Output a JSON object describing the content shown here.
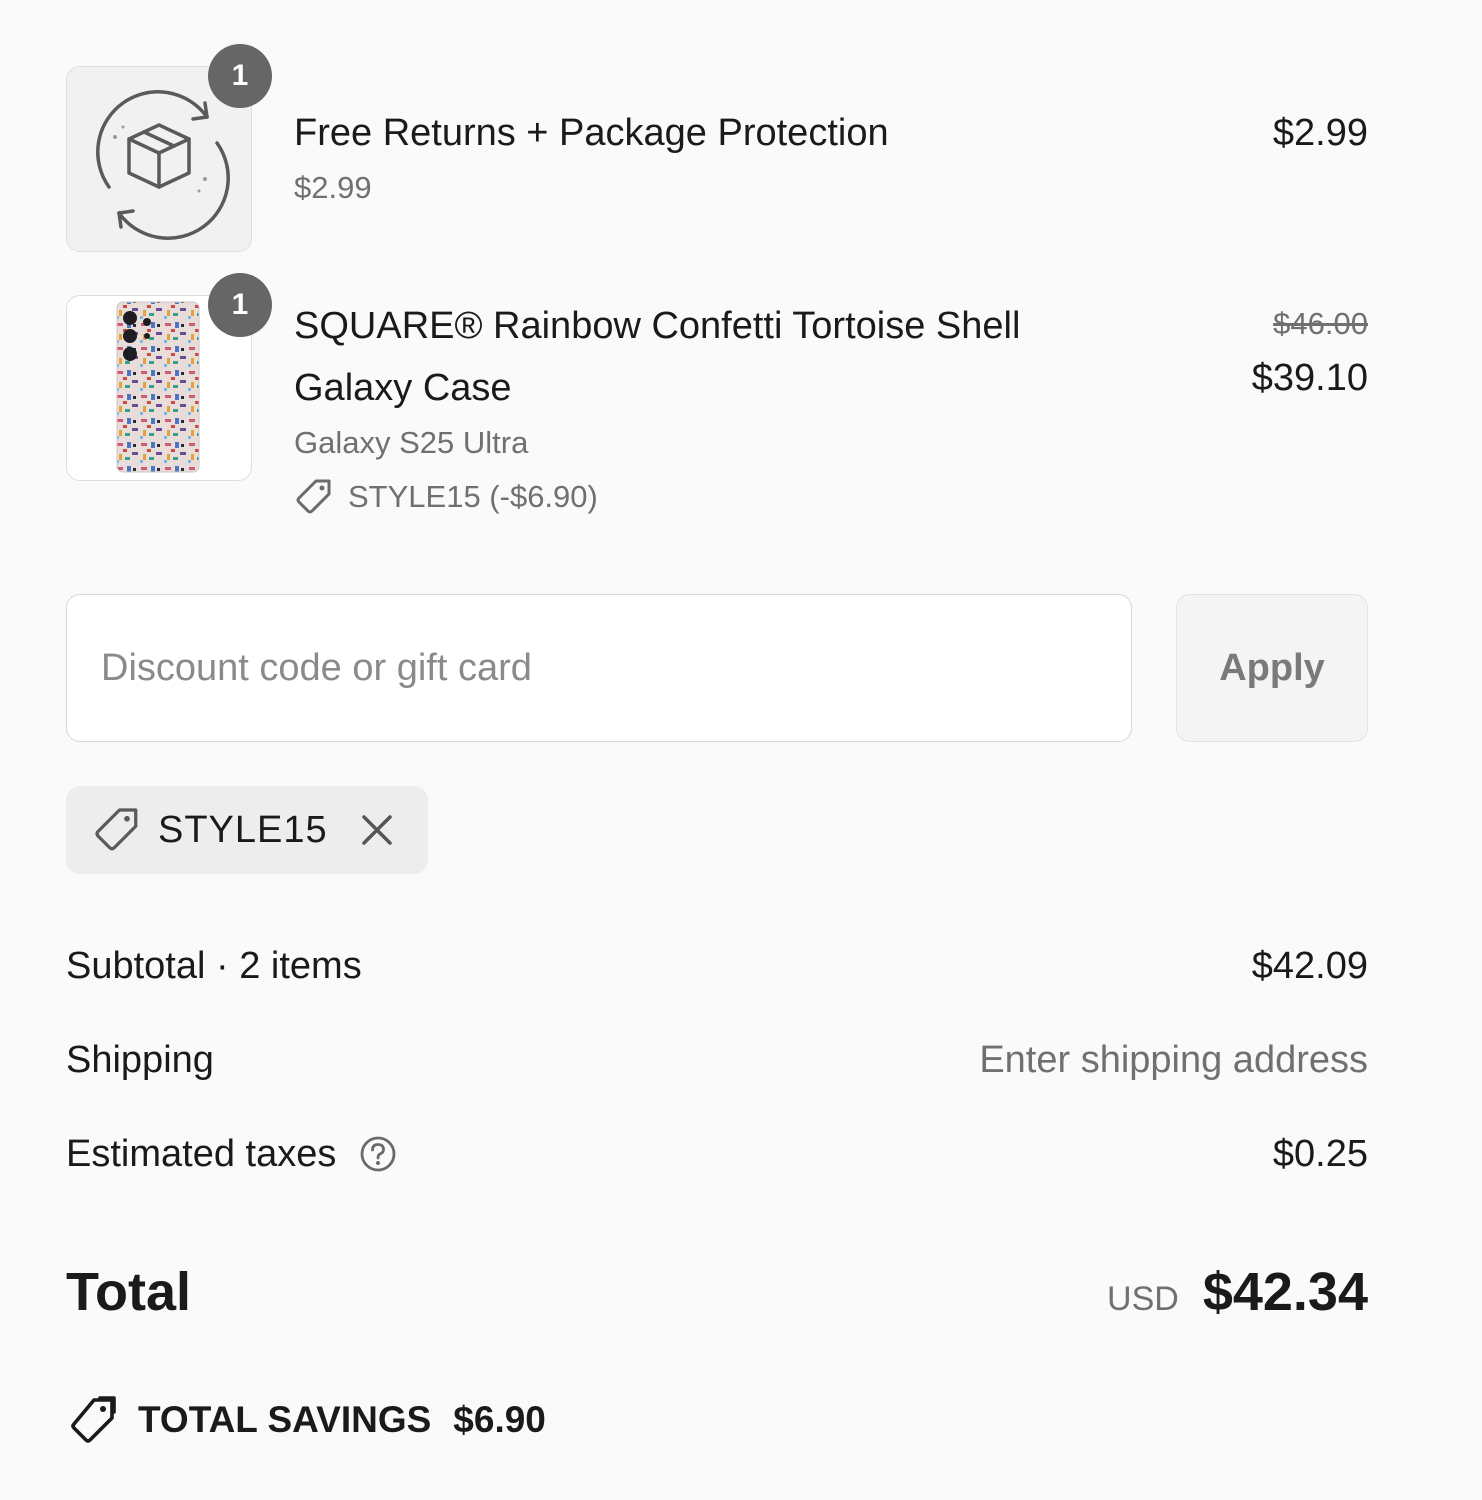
{
  "line_items": [
    {
      "quantity": "1",
      "title": "Free Returns + Package Protection",
      "subtitle": "$2.99",
      "price": "$2.99",
      "image_icon": "box-return-icon"
    },
    {
      "quantity": "1",
      "title_line1": "SQUARE® Rainbow Confetti Tortoise Shell",
      "title_line2": "Galaxy Case",
      "variant": "Galaxy S25 Ultra",
      "discount": "STYLE15 (-$6.90)",
      "original_price": "$46.00",
      "price": "$39.10",
      "image_icon": "phone-case-image"
    }
  ],
  "discount_form": {
    "placeholder": "Discount code or gift card",
    "value": "",
    "apply_label": "Apply"
  },
  "applied_code": {
    "label": "STYLE15"
  },
  "totals": {
    "subtotal_label": "Subtotal · 2 items",
    "subtotal_value": "$42.09",
    "shipping_label": "Shipping",
    "shipping_value": "Enter shipping address",
    "taxes_label": "Estimated taxes",
    "taxes_value": "$0.25",
    "total_label": "Total",
    "currency": "USD",
    "total_value": "$42.34",
    "savings_label": "TOTAL SAVINGS",
    "savings_value": "$6.90"
  },
  "colors": {
    "background": "#fafafa",
    "badge": "#666666",
    "muted_text": "#707070",
    "chip_background": "#ededed"
  }
}
